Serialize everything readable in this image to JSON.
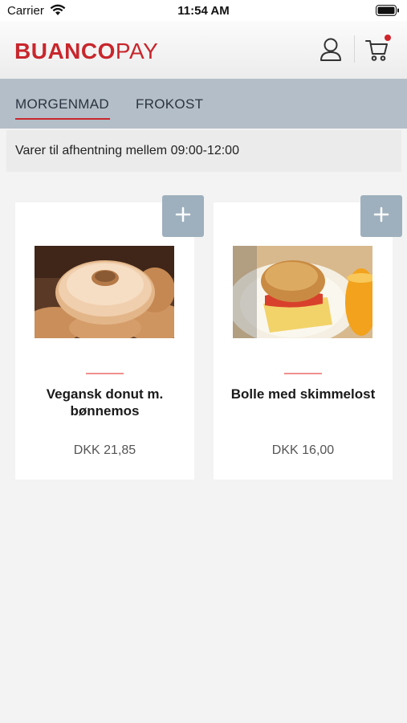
{
  "status_bar": {
    "carrier": "Carrier",
    "time": "11:54 AM"
  },
  "header": {
    "logo_part1": "BUANCO",
    "logo_part2": "PAY",
    "icons": [
      "user-icon",
      "cart-icon"
    ],
    "accent_color": "#c8262c"
  },
  "tabs": [
    {
      "label": "MORGENMAD",
      "active": true
    },
    {
      "label": "FROKOST",
      "active": false
    }
  ],
  "pickup_notice": "Varer til afhentning mellem 09:00-12:00",
  "products": [
    {
      "name": "Vegansk donut m. bønnemos",
      "price": "DKK 21,85",
      "image": "donut-photo"
    },
    {
      "name": "Bolle med skimmelost",
      "price": "DKK 16,00",
      "image": "bun-cheese-photo"
    }
  ],
  "colors": {
    "tabbar_bg": "#b3bec8",
    "add_button_bg": "#9eb0bd",
    "brand_red": "#c8262c"
  }
}
